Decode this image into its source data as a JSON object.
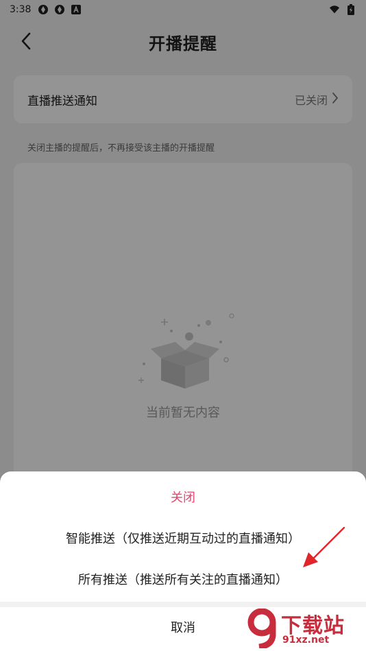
{
  "status_bar": {
    "time": "3:38",
    "left_icons": [
      "shutter-icon",
      "shutter-icon",
      "a-badge-icon"
    ],
    "right_icons": [
      "wifi-icon",
      "battery-charging-icon"
    ]
  },
  "header": {
    "title": "开播提醒",
    "back_icon": "chevron-left-icon"
  },
  "notify": {
    "label": "直播推送通知",
    "status": "已关闭",
    "chevron_icon": "chevron-right-icon"
  },
  "hint": "关闭主播的提醒后，不再接受该主播的开播提醒",
  "empty": {
    "icon": "empty-box-icon",
    "text": "当前暂无内容"
  },
  "sheet": {
    "options": [
      {
        "label": "关闭",
        "color": "#e8416f"
      },
      {
        "label": "智能推送（仅推送近期互动过的直播通知）"
      },
      {
        "label": "所有推送（推送所有关注的直播通知）"
      }
    ],
    "cancel": "取消"
  },
  "watermark": {
    "logo": "9-logo",
    "title": "下载站",
    "domain": "91xz.net"
  },
  "colors": {
    "accent": "#e8416f",
    "overlay": "rgba(0,0,0,0.42)",
    "arrow": "#e0262b"
  }
}
